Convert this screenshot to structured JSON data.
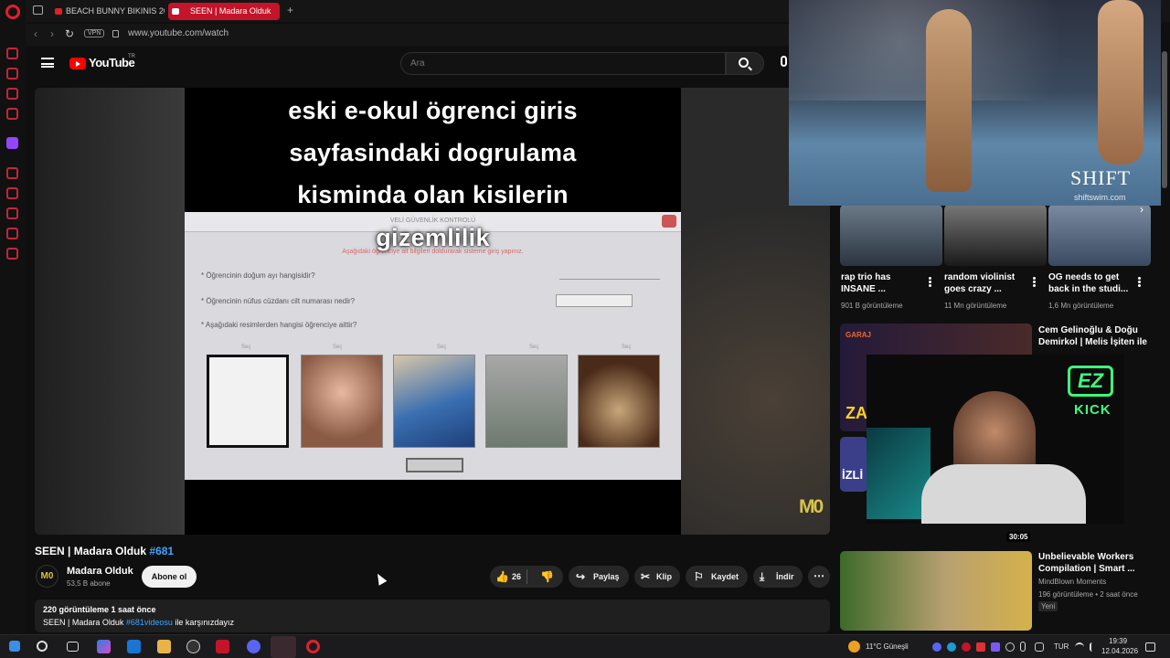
{
  "browser": {
    "tabs": [
      {
        "label": "BEACH BUNNY BIKINIS 20"
      },
      {
        "label": "SEEN | Madara Olduk"
      }
    ],
    "new_tab_label": "+",
    "url": "www.youtube.com/watch",
    "vpn_label": "VPN"
  },
  "header": {
    "logo_text": "YouTube",
    "logo_country": "TR",
    "search_placeholder": "Ara"
  },
  "player": {
    "caption_lines": [
      "eski e-okul ögrenci giris",
      "sayfasindaki dogrulama",
      "kisminda olan kisilerin",
      "gizemlilik"
    ],
    "form_title": "VELİ GÜVENLİK KONTROLÜ",
    "form_red_text": "Aşağıdaki öğrenciye ait bilgileri doldurarak sisteme giriş yapınız.",
    "questions": [
      "* Öğrencinin doğum ayı hangisidir?",
      "* Öğrencinin nüfus cüzdanı cilt numarası nedir?",
      "* Aşağıdaki resimlerden hangisi öğrenciye aittir?"
    ],
    "select_label": "Seç",
    "watermark": "M0"
  },
  "video": {
    "title_main": "SEEN | Madara Olduk",
    "title_hash": "#681",
    "channel_name": "Madara Olduk",
    "channel_avatar": "M0",
    "subscribers": "53,5 B abone",
    "subscribe_label": "Abone ol",
    "likes": "26",
    "share_label": "Paylaş",
    "clip_label": "Klip",
    "save_label": "Kaydet",
    "download_label": "İndir",
    "description_meta": "220 görüntüleme  1 saat önce",
    "description_prefix": "SEEN | Madara Olduk ",
    "description_hash": "#681videosu",
    "description_suffix": " ile karşınızdayız"
  },
  "recommendations": {
    "shorts": [
      {
        "title": "rap trio has INSANE ...",
        "meta": "901 B görüntüleme"
      },
      {
        "title": "random violinist goes crazy ...",
        "meta": "11 Mn görüntüleme"
      },
      {
        "title": "OG needs to get back in the studi...",
        "meta": "1,6 Mn görüntüleme"
      }
    ],
    "videos": [
      {
        "title": "Cem Gelinoğlu & Doğu Demirkol | Melis İşiten ile ...",
        "thumb_text": "GARAJ",
        "thumb_text2": "ZA",
        "thumb_text3": "İZLİ"
      },
      {
        "title": "Unbelievable Workers Compilation | Smart ...",
        "channel": "MindBlown Moments",
        "meta": "196 görüntüleme • 2 saat önce",
        "badge": "Yeni"
      }
    ],
    "duration": "30:05"
  },
  "overlay": {
    "brand": "SHIFT",
    "brand_sub": "shiftswim.com",
    "ez_badge": "EZ",
    "kick_label": "KICK"
  },
  "taskbar": {
    "weather": "11°C  Güneşli",
    "lang": "TUR",
    "time": "19:39",
    "date": "12.04.2026"
  },
  "colors": {
    "accent": "#c4142a",
    "youtube_red": "#ff0000",
    "link_blue": "#3ea6ff",
    "kick_green": "#3dff7a",
    "background": "#0f0f0f"
  }
}
